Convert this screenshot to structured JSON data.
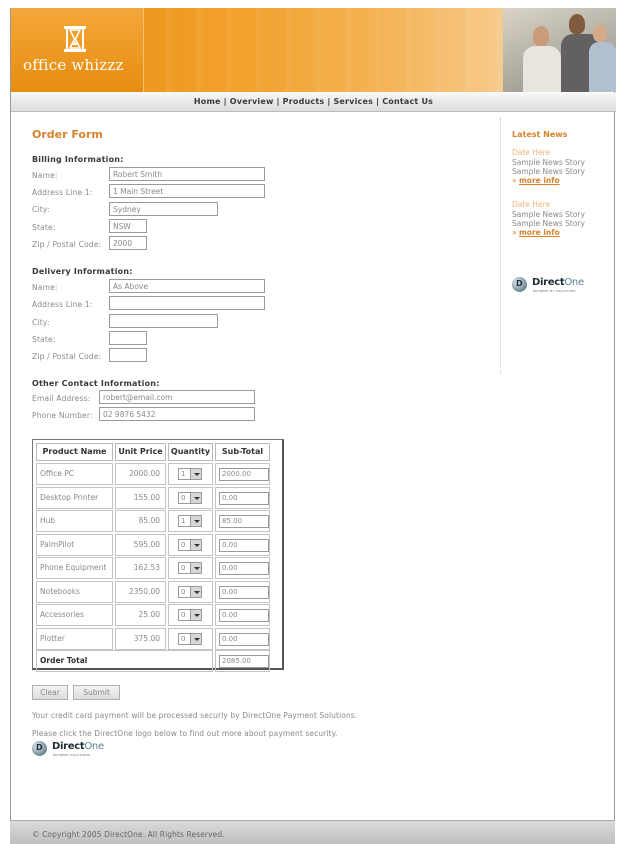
{
  "header": {
    "brand": "office whizzz"
  },
  "nav": {
    "items": [
      "Home",
      "Overview",
      "Products",
      "Services",
      "Contact Us"
    ],
    "separator": "|"
  },
  "form": {
    "title": "Order Form",
    "billing": {
      "title": "Billing Information:",
      "fields": [
        {
          "label": "Name:",
          "value": "Robert Smith"
        },
        {
          "label": "Address Line 1:",
          "value": "1 Main Street"
        },
        {
          "label": "City:",
          "value": "Sydney"
        },
        {
          "label": "State:",
          "value": "NSW"
        },
        {
          "label": "Zip / Postal Code:",
          "value": "2000"
        }
      ]
    },
    "delivery": {
      "title": "Delivery Information:",
      "fields": [
        {
          "label": "Name:",
          "value": "As Above"
        },
        {
          "label": "Address Line 1:",
          "value": ""
        },
        {
          "label": "City:",
          "value": ""
        },
        {
          "label": "State:",
          "value": ""
        },
        {
          "label": "Zip / Postal Code:",
          "value": ""
        }
      ]
    },
    "contact": {
      "title": "Other Contact Information:",
      "fields": [
        {
          "label": "Email Address:",
          "value": "robert@email.com"
        },
        {
          "label": "Phone Number:",
          "value": "02 9876 5432"
        }
      ]
    }
  },
  "table": {
    "headers": [
      "Product Name",
      "Unit Price",
      "Quantity",
      "Sub-Total"
    ],
    "rows": [
      {
        "name": "Office PC",
        "price": "2000.00",
        "qty": "1",
        "subtotal": "2000.00"
      },
      {
        "name": "Desktop Printer",
        "price": "155.00",
        "qty": "0",
        "subtotal": "0.00"
      },
      {
        "name": "Hub",
        "price": "85.00",
        "qty": "1",
        "subtotal": "85.00"
      },
      {
        "name": "PalmPilot",
        "price": "595.00",
        "qty": "0",
        "subtotal": "0.00"
      },
      {
        "name": "Phone Equipment",
        "price": "162.53",
        "qty": "0",
        "subtotal": "0.00"
      },
      {
        "name": "Notebooks",
        "price": "2350.00",
        "qty": "0",
        "subtotal": "0.00"
      },
      {
        "name": "Accessories",
        "price": "25.00",
        "qty": "0",
        "subtotal": "0.00"
      },
      {
        "name": "Plotter",
        "price": "375.00",
        "qty": "0",
        "subtotal": "0.00"
      }
    ],
    "total_label": "Order Total",
    "total_value": "2085.00"
  },
  "buttons": {
    "clear": "Clear",
    "submit": "Submit"
  },
  "notes": {
    "payment": "Your credit card payment will be processed securly by DirectOne Payment Solutions.",
    "security": "Please click the DirectOne logo below to find out more about payment security."
  },
  "sidebar": {
    "title": "Latest News",
    "news": [
      {
        "date": "Date Here",
        "lines": [
          "Sample News Story",
          "Sample News Story"
        ],
        "more": "more info"
      },
      {
        "date": "Date Here",
        "lines": [
          "Sample News Story",
          "Sample News Story"
        ],
        "more": "more info"
      }
    ]
  },
  "directone": {
    "name_part1": "Direct",
    "name_part2": "One",
    "tagline_sidebar": "PAYMENT BY SOLUTIONS",
    "tagline_main": "PAYMENT SOLUTIONS"
  },
  "footer": {
    "copyright": "© Copyright 2005 DirectOne. All Rights Reserved."
  },
  "colors": {
    "accent": "#d9822b",
    "header_orange": "#e98e0c",
    "news_date": "#f0b47a"
  }
}
